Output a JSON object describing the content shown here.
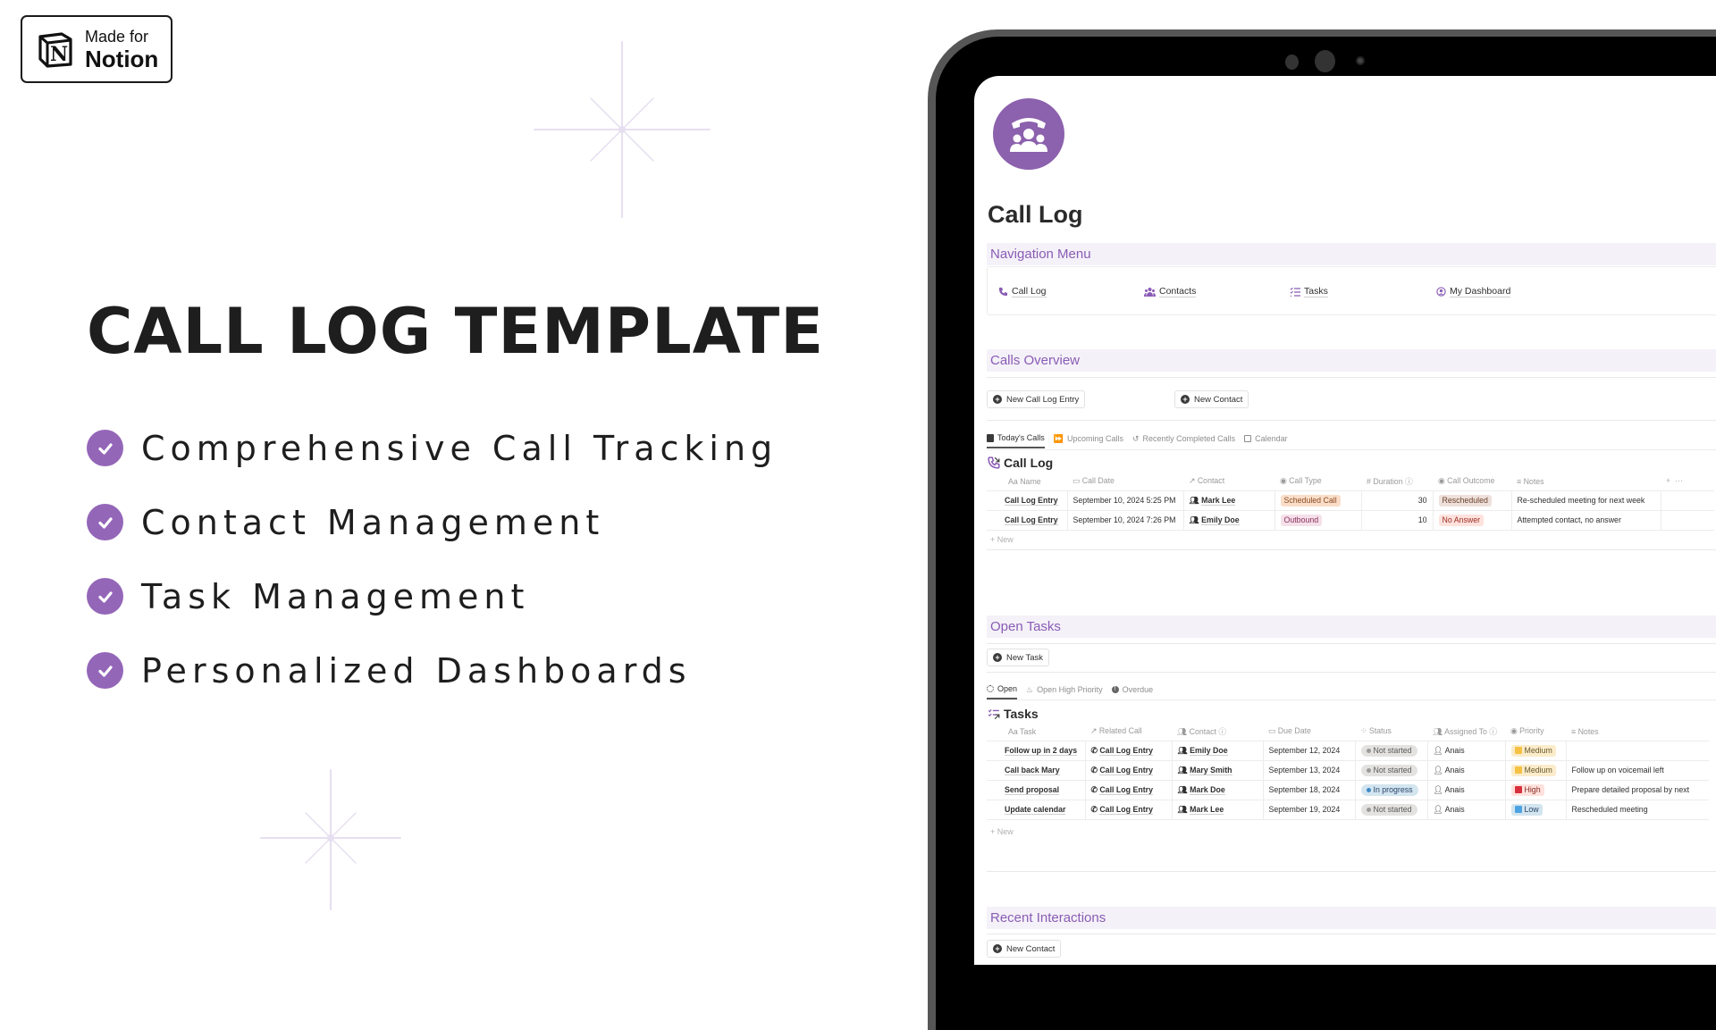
{
  "badge": {
    "line1": "Made for",
    "line2": "Notion"
  },
  "headline": "CALL LOG TEMPLATE",
  "features": [
    {
      "label": "Comprehensive Call Tracking"
    },
    {
      "label": "Contact Management"
    },
    {
      "label": "Task Management"
    },
    {
      "label": "Personalized Dashboards"
    }
  ],
  "colors": {
    "accent": "#8c61ad",
    "check": "#9466b8",
    "section_bg": "#f4f1f8",
    "section_text": "#8a5cb5"
  },
  "page": {
    "icon": "call-contacts-icon",
    "title": "Call Log"
  },
  "navigation": {
    "title": "Navigation Menu",
    "items": [
      {
        "label": "Call Log",
        "icon": "phone-icon"
      },
      {
        "label": "Contacts",
        "icon": "people-icon"
      },
      {
        "label": "Tasks",
        "icon": "checklist-icon"
      },
      {
        "label": "My Dashboard",
        "icon": "user-circle-icon"
      }
    ]
  },
  "calls_overview": {
    "title": "Calls Overview",
    "buttons": [
      {
        "label": "New Call Log Entry"
      },
      {
        "label": "New Contact"
      }
    ],
    "tabs": [
      {
        "label": "Today's Calls",
        "active": true
      },
      {
        "label": "Upcoming Calls",
        "active": false
      },
      {
        "label": "Recently Completed Calls",
        "active": false
      },
      {
        "label": "Calendar",
        "active": false
      }
    ],
    "database_title": "Call Log",
    "columns": [
      "Aa Name",
      "Call Date",
      "Contact",
      "Call Type",
      "Duration",
      "Call Outcome",
      "Notes"
    ],
    "rows": [
      {
        "name": "Call Log Entry",
        "date": "September 10, 2024 5:25 PM",
        "contact": "Mark Lee",
        "type": "Scheduled Call",
        "duration": "30",
        "outcome": "Rescheduled",
        "notes": "Re-scheduled meeting for next week"
      },
      {
        "name": "Call Log Entry",
        "date": "September 10, 2024 7:26 PM",
        "contact": "Emily Doe",
        "type": "Outbound",
        "duration": "10",
        "outcome": "No Answer",
        "notes": "Attempted contact, no answer"
      }
    ],
    "new_label": "New"
  },
  "open_tasks": {
    "title": "Open Tasks",
    "button": "New Task",
    "tabs": [
      {
        "label": "Open",
        "active": true
      },
      {
        "label": "Open High Priority",
        "active": false
      },
      {
        "label": "Overdue",
        "active": false
      }
    ],
    "database_title": "Tasks",
    "columns": [
      "Aa Task",
      "Related Call",
      "Contact",
      "Due Date",
      "Status",
      "Assigned To",
      "Priority",
      "Notes"
    ],
    "rows": [
      {
        "task": "Follow up in 2 days",
        "related": "Call Log Entry",
        "contact": "Emily Doe",
        "due": "September 12, 2024",
        "status": "Not started",
        "assigned": "Anais",
        "priority": "Medium",
        "notes": ""
      },
      {
        "task": "Call back Mary",
        "related": "Call Log Entry",
        "contact": "Mary Smith",
        "due": "September 13, 2024",
        "status": "Not started",
        "assigned": "Anais",
        "priority": "Medium",
        "notes": "Follow up on voicemail left"
      },
      {
        "task": "Send proposal",
        "related": "Call Log Entry",
        "contact": "Mark Doe",
        "due": "September 18, 2024",
        "status": "In progress",
        "assigned": "Anais",
        "priority": "High",
        "notes": "Prepare detailed proposal by next"
      },
      {
        "task": "Update calendar",
        "related": "Call Log Entry",
        "contact": "Mark Lee",
        "due": "September 19, 2024",
        "status": "Not started",
        "assigned": "Anais",
        "priority": "Low",
        "notes": "Rescheduled meeting"
      }
    ],
    "new_label": "New"
  },
  "recent_interactions": {
    "title": "Recent Interactions",
    "button": "New Contact"
  }
}
